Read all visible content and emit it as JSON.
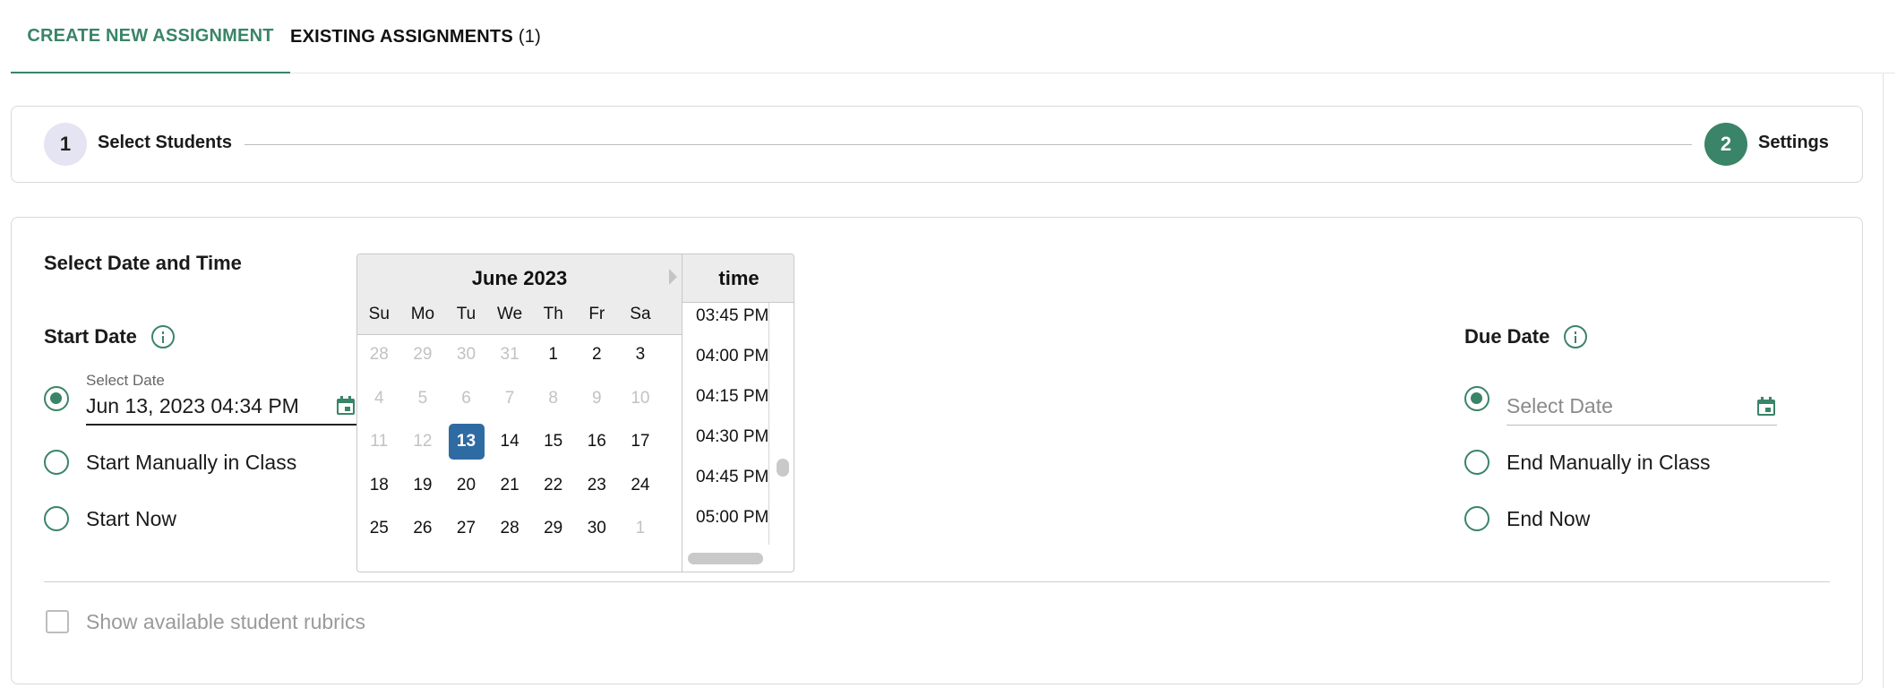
{
  "tabs": {
    "create_label": "CREATE NEW ASSIGNMENT",
    "existing_label": "EXISTING ASSIGNMENTS",
    "existing_count": "(1)"
  },
  "stepper": {
    "step1_number": "1",
    "step1_label": "Select Students",
    "step2_number": "2",
    "step2_label": "Settings"
  },
  "settings": {
    "section_title": "Select Date and Time",
    "start": {
      "title": "Start Date",
      "field_caption": "Select Date",
      "field_value": "Jun 13, 2023 04:34 PM",
      "option_manual": "Start Manually in Class",
      "option_now": "Start Now",
      "selected_option": "date"
    },
    "due": {
      "title": "Due Date",
      "field_placeholder": "Select Date",
      "option_manual": "End Manually in Class",
      "option_now": "End Now",
      "selected_option": "date"
    },
    "rubrics_label": "Show available student rubrics",
    "rubrics_checked": false
  },
  "datepicker": {
    "month_title": "June 2023",
    "weekdays": [
      "Su",
      "Mo",
      "Tu",
      "We",
      "Th",
      "Fr",
      "Sa"
    ],
    "weeks": [
      [
        "28",
        "29",
        "30",
        "31",
        "1",
        "2",
        "3"
      ],
      [
        "4",
        "5",
        "6",
        "7",
        "8",
        "9",
        "10"
      ],
      [
        "11",
        "12",
        "13",
        "14",
        "15",
        "16",
        "17"
      ],
      [
        "18",
        "19",
        "20",
        "21",
        "22",
        "23",
        "24"
      ],
      [
        "25",
        "26",
        "27",
        "28",
        "29",
        "30",
        "1"
      ]
    ],
    "selected_day": "13",
    "time_header": "time",
    "times": [
      "03:45 PM",
      "04:00 PM",
      "04:15 PM",
      "04:30 PM",
      "04:45 PM",
      "05:00 PM"
    ]
  },
  "colors": {
    "accent": "#3a8468",
    "selected_day": "#2f6ba3",
    "step_pending": "#e5e4f2"
  }
}
